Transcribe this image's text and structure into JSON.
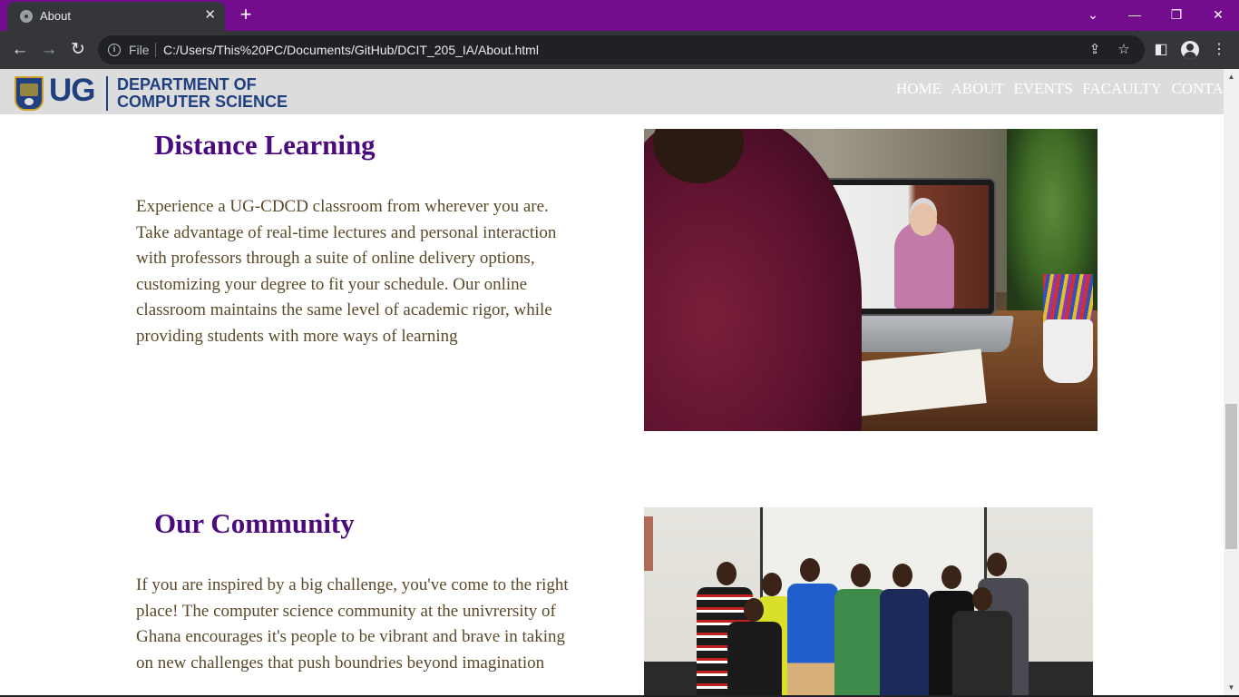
{
  "browser": {
    "tab_title": "About",
    "tab_close": "✕",
    "new_tab": "+",
    "file_label": "File",
    "url": "C:/Users/This%20PC/Documents/GitHub/DCIT_205_IA/About.html",
    "window_controls": {
      "dropdown": "⌄",
      "minimize": "—",
      "restore": "❐",
      "close": "✕"
    },
    "nav": {
      "back": "←",
      "forward": "→",
      "reload": "↻"
    },
    "icons": [
      "share-icon",
      "bookmark-star-icon",
      "side-panel-icon",
      "profile-icon",
      "menu-icon"
    ],
    "theme_color": "#740c8e"
  },
  "site": {
    "logo_ug": "UG",
    "logo_dept_line1": "DEPARTMENT OF",
    "logo_dept_line2": "COMPUTER SCIENCE",
    "nav": [
      "HOME",
      "ABOUT",
      "EVENTS",
      "FACAULTY",
      "CONTACT"
    ]
  },
  "sections": [
    {
      "title": "Distance Learning",
      "text": "Experience a UG-CDCD classroom from wherever you are. Take advantage of real-time lectures and personal interaction with professors through a suite of online delivery options, customizing your degree to fit your schedule. Our online classroom maintains the same level of academic rigor, while providing students with more ways of learning",
      "image": "student-watching-online-lecture-photo"
    },
    {
      "title": "Our Community",
      "text": "If you are inspired by a big challenge, you've come to the right place! The computer science community at the univrersity of Ghana encourages it's people to be vibrant and brave in taking on new challenges that push boundries beyond imagination",
      "image": "group-of-students-photo"
    }
  ],
  "colors": {
    "heading": "#4b0a7d",
    "body_text": "#5a4a2a",
    "header_bg": "#dcdcdc",
    "logo_blue": "#1f3f7f"
  }
}
